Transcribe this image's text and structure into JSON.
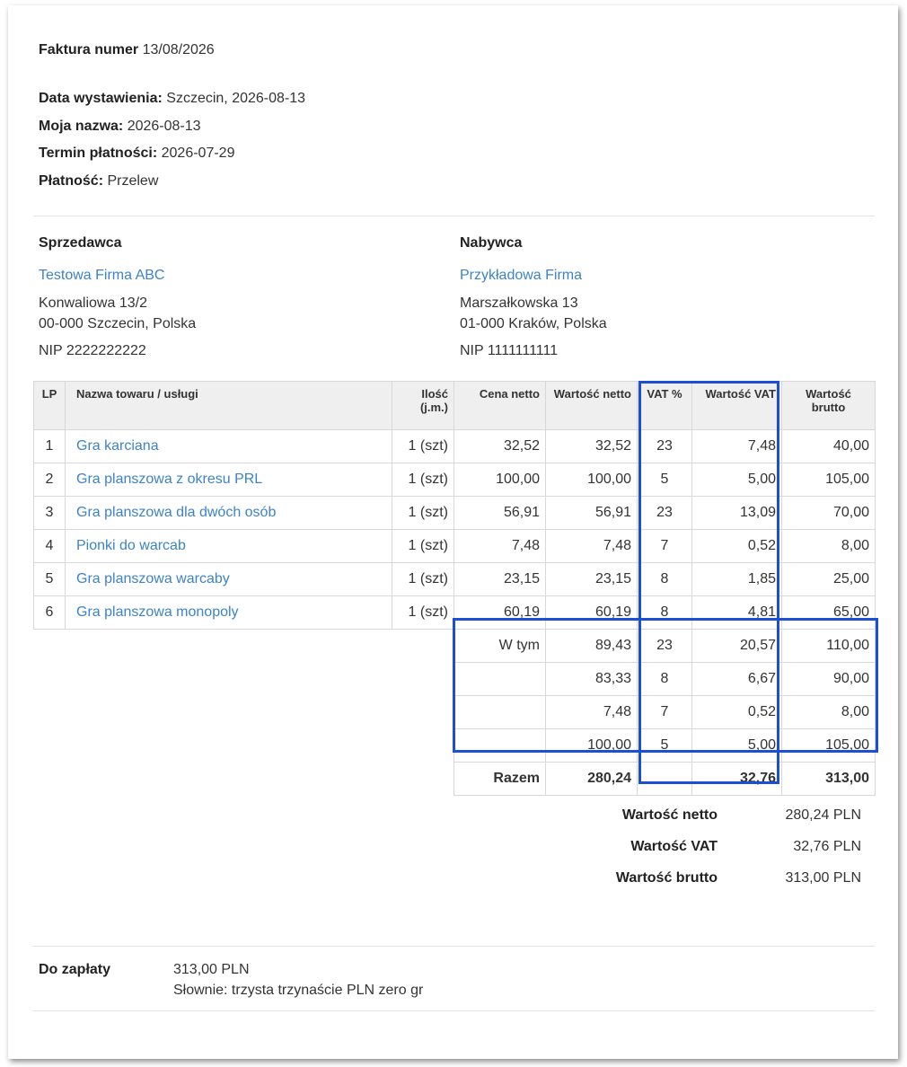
{
  "invoice": {
    "number_label": "Faktura numer",
    "number": "13/08/2026",
    "fields": [
      {
        "label": "Data wystawienia:",
        "value": "Szczecin, 2026-08-13"
      },
      {
        "label": "Moja nazwa:",
        "value": "2026-08-13"
      },
      {
        "label": "Termin płatności:",
        "value": "2026-07-29"
      },
      {
        "label": "Płatność:",
        "value": "Przelew"
      }
    ]
  },
  "seller": {
    "title": "Sprzedawca",
    "name": "Testowa Firma ABC",
    "street": "Konwaliowa 13/2",
    "city": "00-000 Szczecin, Polska",
    "nip": "NIP 2222222222"
  },
  "buyer": {
    "title": "Nabywca",
    "name": "Przykładowa Firma",
    "street": "Marszałkowska 13",
    "city": "01-000 Kraków, Polska",
    "nip": "NIP 1111111111"
  },
  "table": {
    "headers": {
      "lp": "LP",
      "name": "Nazwa towaru / usługi",
      "qty": "Ilość (j.m.)",
      "price": "Cena netto",
      "net": "Wartość netto",
      "vat_pct": "VAT %",
      "vat_val": "Wartość VAT",
      "gross": "Wartość brutto"
    },
    "rows": [
      {
        "lp": "1",
        "name": "Gra karciana",
        "qty": "1 (szt)",
        "price": "32,52",
        "net": "32,52",
        "vat_pct": "23",
        "vat_val": "7,48",
        "gross": "40,00"
      },
      {
        "lp": "2",
        "name": "Gra planszowa z okresu PRL",
        "qty": "1 (szt)",
        "price": "100,00",
        "net": "100,00",
        "vat_pct": "5",
        "vat_val": "5,00",
        "gross": "105,00"
      },
      {
        "lp": "3",
        "name": "Gra planszowa dla dwóch osób",
        "qty": "1 (szt)",
        "price": "56,91",
        "net": "56,91",
        "vat_pct": "23",
        "vat_val": "13,09",
        "gross": "70,00"
      },
      {
        "lp": "4",
        "name": "Pionki do warcab",
        "qty": "1 (szt)",
        "price": "7,48",
        "net": "7,48",
        "vat_pct": "7",
        "vat_val": "0,52",
        "gross": "8,00"
      },
      {
        "lp": "5",
        "name": "Gra planszowa warcaby",
        "qty": "1 (szt)",
        "price": "23,15",
        "net": "23,15",
        "vat_pct": "8",
        "vat_val": "1,85",
        "gross": "25,00"
      },
      {
        "lp": "6",
        "name": "Gra planszowa monopoly",
        "qty": "1 (szt)",
        "price": "60,19",
        "net": "60,19",
        "vat_pct": "8",
        "vat_val": "4,81",
        "gross": "65,00"
      }
    ],
    "breakdown_label": "W tym",
    "breakdown": [
      {
        "net": "89,43",
        "vat_pct": "23",
        "vat_val": "20,57",
        "gross": "110,00"
      },
      {
        "net": "83,33",
        "vat_pct": "8",
        "vat_val": "6,67",
        "gross": "90,00"
      },
      {
        "net": "7,48",
        "vat_pct": "7",
        "vat_val": "0,52",
        "gross": "8,00"
      },
      {
        "net": "100,00",
        "vat_pct": "5",
        "vat_val": "5,00",
        "gross": "105,00"
      }
    ],
    "total": {
      "label": "Razem",
      "net": "280,24",
      "vat_val": "32,76",
      "gross": "313,00"
    }
  },
  "summary": [
    {
      "label": "Wartość netto",
      "value": "280,24 PLN"
    },
    {
      "label": "Wartość VAT",
      "value": "32,76 PLN"
    },
    {
      "label": "Wartość brutto",
      "value": "313,00 PLN"
    }
  ],
  "payment": {
    "label": "Do zapłaty",
    "amount": "313,00 PLN",
    "words": "Słownie: trzysta trzynaście PLN zero gr"
  },
  "colors": {
    "link": "#3d83c6",
    "highlight": "#1a4fd6"
  }
}
